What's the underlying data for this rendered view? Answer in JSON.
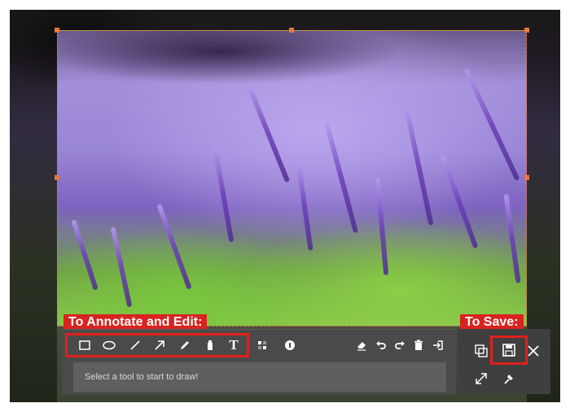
{
  "labels": {
    "annotate": "To Annotate and Edit:",
    "save": "To Save:"
  },
  "status": {
    "text": "Select a tool to start to draw!"
  },
  "tools": [
    {
      "name": "rectangle-icon"
    },
    {
      "name": "ellipse-icon"
    },
    {
      "name": "line-icon"
    },
    {
      "name": "arrow-icon"
    },
    {
      "name": "pencil-icon"
    },
    {
      "name": "highlighter-icon"
    },
    {
      "name": "text-icon",
      "glyph": "T"
    },
    {
      "name": "mosaic-icon"
    },
    {
      "name": "step-number-icon"
    },
    {
      "name": "eraser-icon"
    },
    {
      "name": "undo-icon"
    },
    {
      "name": "redo-icon"
    },
    {
      "name": "delete-icon"
    },
    {
      "name": "exit-icon"
    }
  ],
  "right_tools": [
    {
      "name": "copy-icon"
    },
    {
      "name": "save-icon"
    },
    {
      "name": "close-icon"
    },
    {
      "name": "fullscreen-icon"
    },
    {
      "name": "pin-icon"
    }
  ],
  "colors": {
    "selection_border": "#e8773d",
    "highlight_red": "#e0201c",
    "toolbar_bg": "#4a4a4a",
    "icon": "#ffffff"
  }
}
